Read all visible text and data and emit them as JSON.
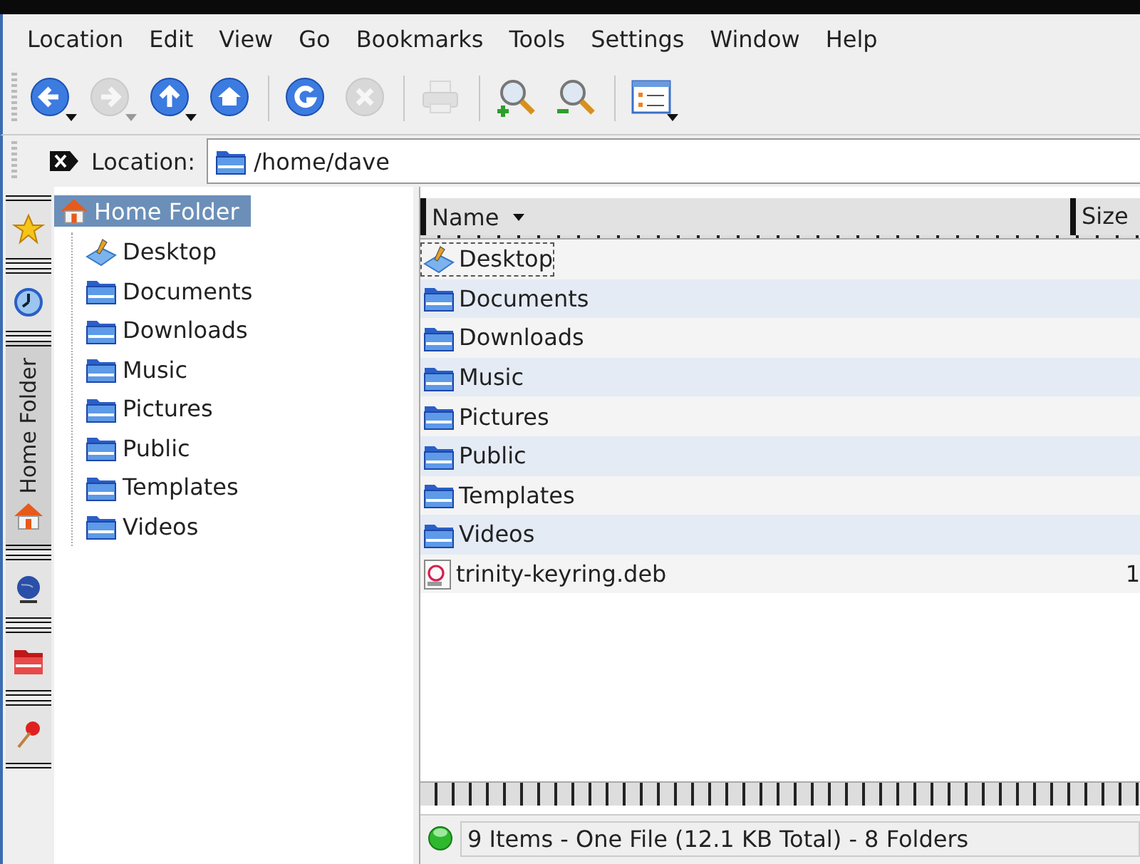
{
  "menu": [
    "Location",
    "Edit",
    "View",
    "Go",
    "Bookmarks",
    "Tools",
    "Settings",
    "Window",
    "Help"
  ],
  "toolbar": [
    {
      "kind": "back",
      "disabled": false,
      "dropdown": true
    },
    {
      "kind": "forward",
      "disabled": true,
      "dropdown": true
    },
    {
      "kind": "up",
      "disabled": false,
      "dropdown": true
    },
    {
      "kind": "home",
      "disabled": false
    },
    {
      "kind": "separator"
    },
    {
      "kind": "reload",
      "disabled": false
    },
    {
      "kind": "stop",
      "disabled": true
    },
    {
      "kind": "separator"
    },
    {
      "kind": "print",
      "disabled": true
    },
    {
      "kind": "separator"
    },
    {
      "kind": "zoom-in",
      "disabled": false
    },
    {
      "kind": "zoom-out",
      "disabled": false
    },
    {
      "kind": "separator"
    },
    {
      "kind": "view-mode",
      "disabled": false,
      "dropdown": true
    }
  ],
  "location": {
    "label": "Location:",
    "value": "/home/dave"
  },
  "side_tabs": [
    {
      "kind": "star",
      "selected": false
    },
    {
      "kind": "clock",
      "selected": false
    },
    {
      "kind": "home",
      "label": "Home Folder",
      "selected": true
    },
    {
      "kind": "globe",
      "selected": false
    },
    {
      "kind": "red-folder",
      "selected": false
    },
    {
      "kind": "pin",
      "selected": false
    }
  ],
  "tree": {
    "label": "Home Folder",
    "selected": true,
    "children": [
      {
        "label": "Desktop",
        "kind": "desktop"
      },
      {
        "label": "Documents",
        "kind": "folder"
      },
      {
        "label": "Downloads",
        "kind": "folder"
      },
      {
        "label": "Music",
        "kind": "folder"
      },
      {
        "label": "Pictures",
        "kind": "folder"
      },
      {
        "label": "Public",
        "kind": "folder"
      },
      {
        "label": "Templates",
        "kind": "folder"
      },
      {
        "label": "Videos",
        "kind": "folder"
      }
    ]
  },
  "file_list": {
    "columns": [
      "Name",
      "Size"
    ],
    "rows": [
      {
        "name": "Desktop",
        "kind": "desktop",
        "focused": true
      },
      {
        "name": "Documents",
        "kind": "folder",
        "focused": false
      },
      {
        "name": "Downloads",
        "kind": "folder",
        "focused": false
      },
      {
        "name": "Music",
        "kind": "folder",
        "focused": false
      },
      {
        "name": "Pictures",
        "kind": "folder",
        "focused": false
      },
      {
        "name": "Public",
        "kind": "folder",
        "focused": false
      },
      {
        "name": "Templates",
        "kind": "folder",
        "focused": false
      },
      {
        "name": "Videos",
        "kind": "folder",
        "focused": false
      },
      {
        "name": "trinity-keyring.deb",
        "kind": "package",
        "focused": false,
        "size": "1"
      }
    ]
  },
  "status_bar": {
    "text": "9 Items - One File (12.1 KB Total) - 8 Folders"
  }
}
